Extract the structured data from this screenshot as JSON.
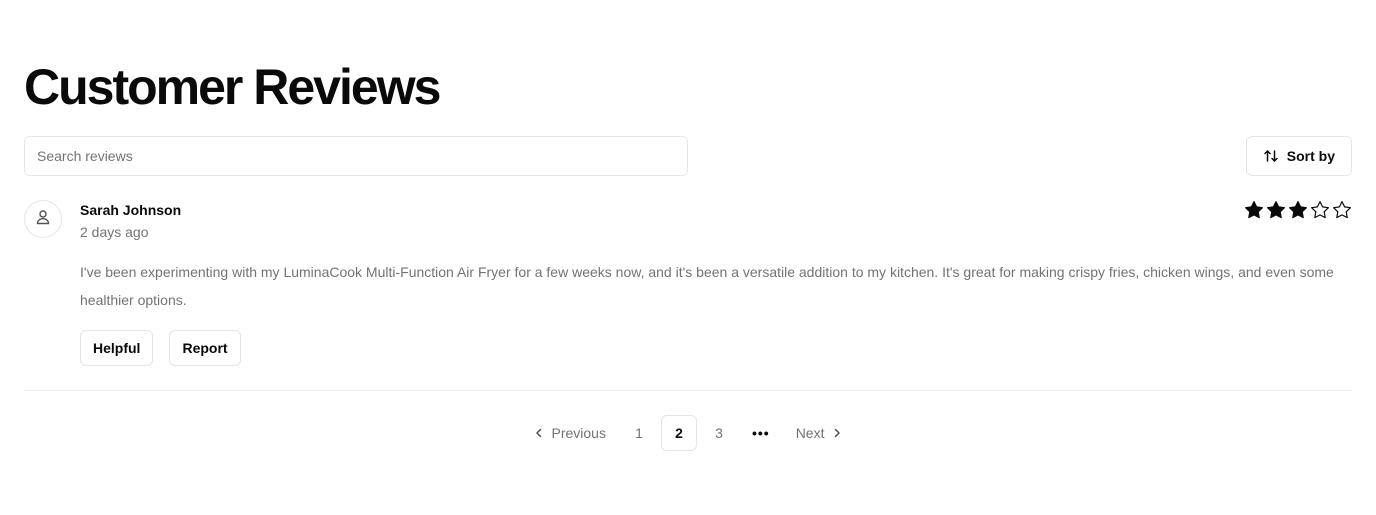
{
  "page": {
    "title": "Customer Reviews"
  },
  "search": {
    "placeholder": "Search reviews",
    "value": ""
  },
  "sort": {
    "label": "Sort by",
    "icon": "arrow-up-down-icon"
  },
  "review": {
    "author": "Sarah Johnson",
    "date": "2 days ago",
    "avatar_icon": "user-icon",
    "rating": 3,
    "rating_max": 5,
    "body": "I've been experimenting with my LuminaCook Multi-Function Air Fryer for a few weeks now, and it's been a versatile addition to my kitchen. It's great for making crispy fries, chicken wings, and even some healthier options.",
    "actions": {
      "helpful_label": "Helpful",
      "report_label": "Report"
    }
  },
  "pagination": {
    "previous_label": "Previous",
    "next_label": "Next",
    "pages": [
      "1",
      "2",
      "3"
    ],
    "current": "2",
    "ellipsis": "•••"
  },
  "colors": {
    "text": "#0a0a0a",
    "muted": "#737373",
    "border": "#e5e5e5",
    "star": "#0a0a0a"
  }
}
